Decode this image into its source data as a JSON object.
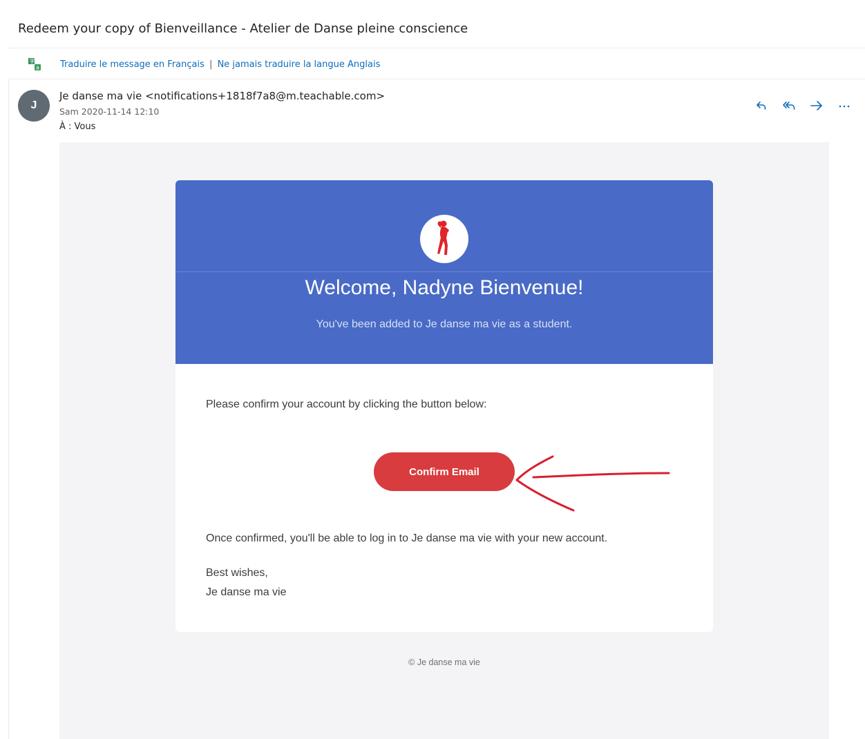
{
  "email": {
    "subject": "Redeem your copy of Bienveillance - Atelier de Danse pleine conscience",
    "translate": {
      "translate_link": "Traduire le message en Français",
      "separator": "|",
      "never_link": "Ne jamais traduire la langue Anglais"
    },
    "sender": {
      "avatar_initial": "J",
      "from": "Je danse ma vie <notifications+1818f7a8@m.teachable.com>",
      "date": "Sam 2020-11-14 12:10",
      "to_label": "À :",
      "to_value": "Vous"
    },
    "actions": {
      "reply": "reply-icon",
      "reply_all": "reply-all-icon",
      "forward": "forward-icon",
      "more": "more-icon"
    }
  },
  "message": {
    "welcome": "Welcome, Nadyne Bienvenue!",
    "added_text": "You've been added to Je danse ma vie as a student.",
    "confirm_prompt": "Please confirm your account by clicking the button below:",
    "confirm_button": "Confirm Email",
    "once_confirmed": "Once confirmed, you'll be able to log in to Je danse ma vie with your new account.",
    "best_wishes": "Best wishes,",
    "signature": "Je danse ma vie",
    "footer": "© Je danse ma vie"
  },
  "colors": {
    "hero": "#496ac6",
    "button": "#d83c3e",
    "link": "#0f6cbd",
    "annotation": "#d8202e"
  }
}
